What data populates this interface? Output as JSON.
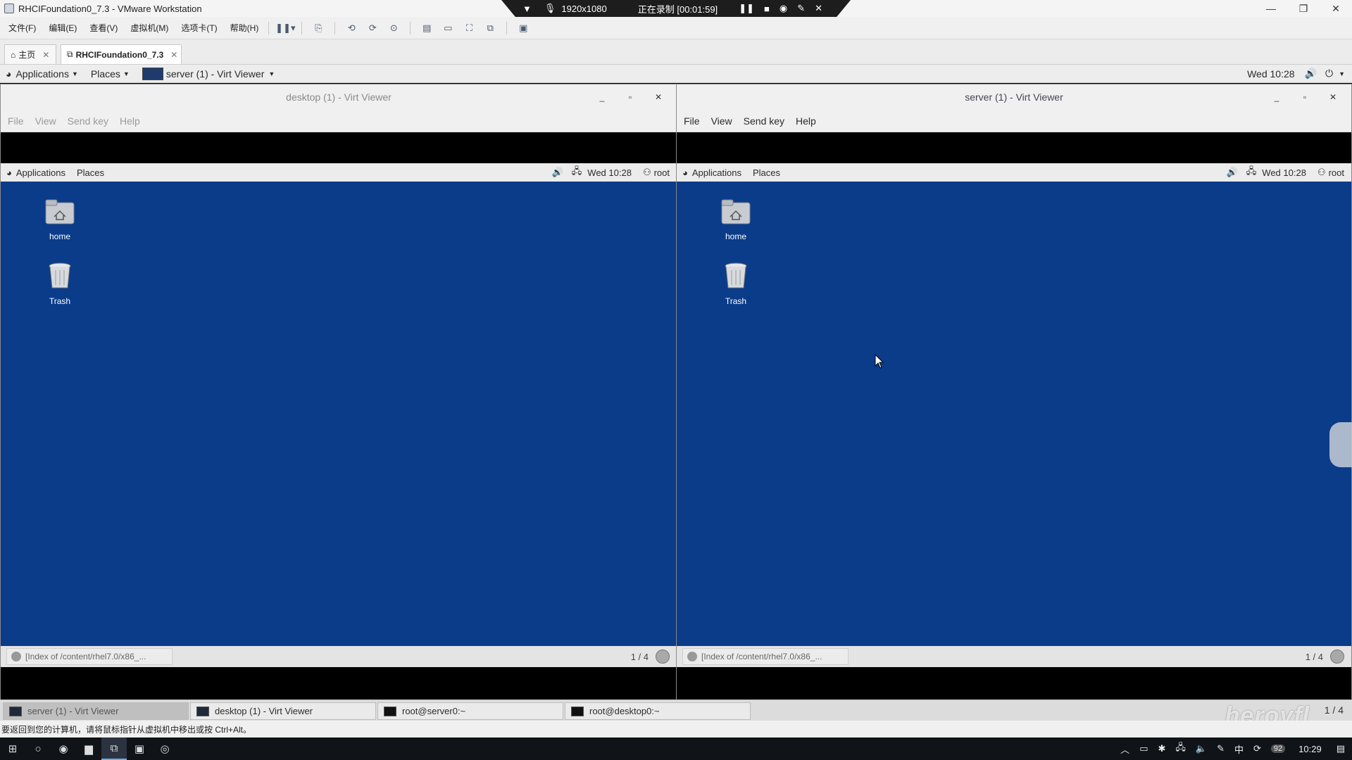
{
  "vmware": {
    "title": "RHCIFoundation0_7.3 - VMware Workstation",
    "menu": [
      "文件(F)",
      "编辑(E)",
      "查看(V)",
      "虚拟机(M)",
      "选项卡(T)",
      "帮助(H)"
    ],
    "tabs": [
      {
        "label": "主页",
        "active": false
      },
      {
        "label": "RHCIFoundation0_7.3",
        "active": true
      }
    ],
    "status_text": "要返回到您的计算机，请将鼠标指针从虚拟机中移出或按 Ctrl+Alt。"
  },
  "recording_bar": {
    "resolution": "1920x1080",
    "recording": "正在录制 [00:01:59]"
  },
  "guest_topbar": {
    "applications": "Applications",
    "places": "Places",
    "active_window": "server (1) - Virt Viewer",
    "clock": "Wed 10:28"
  },
  "viewer_left": {
    "title": "desktop (1) - Virt Viewer",
    "menu": [
      "File",
      "View",
      "Send key",
      "Help"
    ],
    "topbar": {
      "applications": "Applications",
      "places": "Places",
      "clock": "Wed 10:28",
      "user": "root"
    },
    "icons": [
      {
        "label": "home"
      },
      {
        "label": "Trash"
      }
    ],
    "task": "[Index of /content/rhel7.0/x86_...",
    "pager": "1 / 4"
  },
  "viewer_right": {
    "title": "server (1) - Virt Viewer",
    "menu": [
      "File",
      "View",
      "Send key",
      "Help"
    ],
    "topbar": {
      "applications": "Applications",
      "places": "Places",
      "clock": "Wed 10:28",
      "user": "root"
    },
    "icons": [
      {
        "label": "home"
      },
      {
        "label": "Trash"
      }
    ],
    "task": "[Index of /content/rhel7.0/x86_...",
    "pager": "1 / 4"
  },
  "guest_taskbar": {
    "items": [
      {
        "label": "server (1) - Virt Viewer",
        "active": true
      },
      {
        "label": "desktop (1) - Virt Viewer",
        "active": false
      },
      {
        "label": "root@server0:~",
        "active": false
      },
      {
        "label": "root@desktop0:~",
        "active": false
      }
    ],
    "pager": "1 / 4"
  },
  "watermark": "heroyfl",
  "windows_taskbar": {
    "ime": "中",
    "badge": "92",
    "clock": "10:29"
  },
  "colors": {
    "desktop_blue": "#0a3c8a",
    "chrome_gray": "#f0f0f0",
    "win_taskbar": "#101419"
  }
}
